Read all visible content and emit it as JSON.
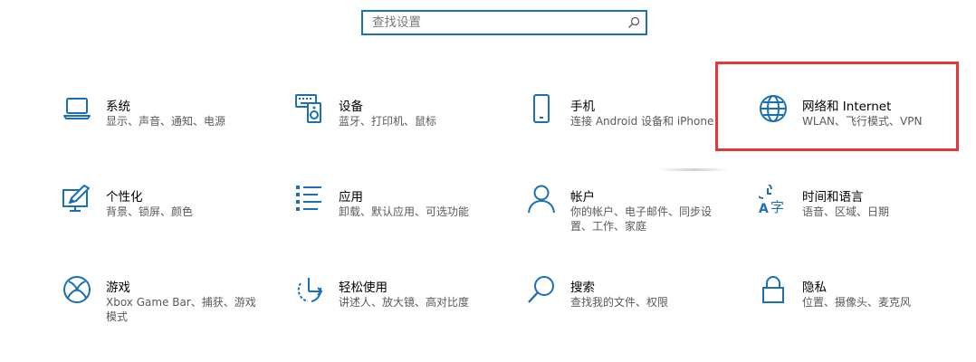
{
  "search": {
    "placeholder": "查找设置"
  },
  "colors": {
    "accent": "#1a6fb6",
    "highlight": "#e0383c"
  },
  "tiles": [
    {
      "title": "系统",
      "desc": "显示、声音、通知、电源",
      "icon": "laptop-icon"
    },
    {
      "title": "设备",
      "desc": "蓝牙、打印机、鼠标",
      "icon": "keyboard-speaker-icon"
    },
    {
      "title": "手机",
      "desc": "连接 Android 设备和 iPhone",
      "icon": "phone-icon"
    },
    {
      "title": "网络和 Internet",
      "desc": "WLAN、飞行模式、VPN",
      "icon": "globe-icon"
    },
    {
      "title": "个性化",
      "desc": "背景、锁屏、颜色",
      "icon": "paint-monitor-icon"
    },
    {
      "title": "应用",
      "desc": "卸载、默认应用、可选功能",
      "icon": "apps-list-icon"
    },
    {
      "title": "帐户",
      "desc": "你的帐户、电子邮件、同步设置、工作、家庭",
      "icon": "person-icon"
    },
    {
      "title": "时间和语言",
      "desc": "语音、区域、日期",
      "icon": "time-language-icon"
    },
    {
      "title": "游戏",
      "desc": "Xbox Game Bar、捕获、游戏模式",
      "icon": "xbox-icon"
    },
    {
      "title": "轻松使用",
      "desc": "讲述人、放大镜、高对比度",
      "icon": "ease-of-access-icon"
    },
    {
      "title": "搜索",
      "desc": "查找我的文件、权限",
      "icon": "search-icon"
    },
    {
      "title": "隐私",
      "desc": "位置、摄像头、麦克风",
      "icon": "lock-icon"
    }
  ]
}
